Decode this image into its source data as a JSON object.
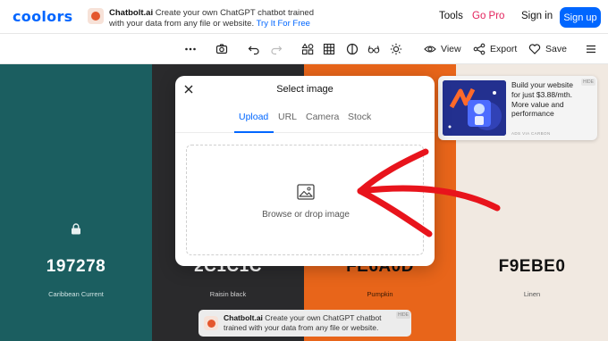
{
  "brand": {
    "logo": "coolors",
    "accent": "#0066ff"
  },
  "topbar": {
    "promo": {
      "title": "Chatbolt.ai",
      "line1": "Create your own ChatGPT chatbot trained",
      "line2": "with your data from any file or website.",
      "cta": "Try It For Free"
    },
    "tools_label": "Tools",
    "gopro_label": "Go Pro",
    "signin_label": "Sign in",
    "signup_label": "Sign up"
  },
  "toolbar": {
    "more_icon": "more-horizontal-icon",
    "view_label": "View",
    "export_label": "Export",
    "save_label": "Save"
  },
  "palette": [
    {
      "hex": "197278",
      "name": "Caribbean Current",
      "color": "#1b5e60",
      "text": "#ffffff",
      "sub": "#cfe3e3",
      "locked": true
    },
    {
      "hex": "2C1C1C",
      "name": "Raisin black",
      "color": "#2a2a2c",
      "text": "#ffffff",
      "sub": "#d0d0d0",
      "locked": false
    },
    {
      "hex": "FE6A0D",
      "name": "Pumpkin",
      "color": "#e8651a",
      "text": "#111111",
      "sub": "#3a1a05",
      "locked": false
    },
    {
      "hex": "F9EBE0",
      "name": "Linen",
      "color": "#f1e9e1",
      "text": "#111111",
      "sub": "#555555",
      "locked": false
    }
  ],
  "carbon_ad": {
    "text": "Build your website for just $3.88/mth. More value and performance",
    "by": "ADS VIA CARBON",
    "hide": "HIDE"
  },
  "bottom_ad": {
    "title": "Chatbolt.ai",
    "text": "Create your own ChatGPT chatbot trained with your data from any file or website.",
    "hide": "HIDE"
  },
  "modal": {
    "title": "Select image",
    "tabs": [
      "Upload",
      "URL",
      "Camera",
      "Stock"
    ],
    "active_tab": "Upload",
    "dropzone_label": "Browse or drop image"
  },
  "annotation_color": "#e8141c"
}
